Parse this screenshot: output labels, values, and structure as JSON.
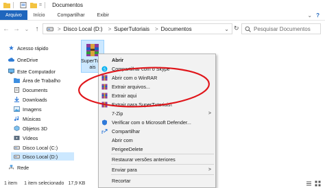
{
  "window": {
    "title": "Documentos",
    "quick_access_divider": "|",
    "dropdown": "="
  },
  "ribbon": {
    "tabs": [
      "Arquivo",
      "Início",
      "Compartilhar",
      "Exibir"
    ],
    "collapse": "⌄",
    "help": "?"
  },
  "address": {
    "back": "←",
    "forward": "→",
    "dropdown": "⌄",
    "up": "↑",
    "path": [
      "Disco Local (D:)",
      "SuperTutoriais",
      "Documentos"
    ],
    "separator": ">",
    "path_dropdown": "⌄",
    "refresh": "↻",
    "search_placeholder": "Pesquisar Documentos"
  },
  "sidebar": {
    "items": [
      {
        "label": "Acesso rápido",
        "icon": "star-icon"
      },
      {
        "label": "OneDrive",
        "icon": "cloud-icon"
      },
      {
        "label": "Este Computador",
        "icon": "computer-icon"
      },
      {
        "label": "Área de Trabalho",
        "icon": "desktop-folder-icon"
      },
      {
        "label": "Documents",
        "icon": "documents-folder-icon"
      },
      {
        "label": "Downloads",
        "icon": "download-icon"
      },
      {
        "label": "Imagens",
        "icon": "pictures-folder-icon"
      },
      {
        "label": "Músicas",
        "icon": "music-icon"
      },
      {
        "label": "Objetos 3D",
        "icon": "objects3d-icon"
      },
      {
        "label": "Vídeos",
        "icon": "video-icon"
      },
      {
        "label": "Disco Local (C:)",
        "icon": "drive-icon"
      },
      {
        "label": "Disco Local (D:)",
        "icon": "drive-icon"
      },
      {
        "label": "Rede",
        "icon": "network-icon"
      }
    ]
  },
  "file": {
    "name": "SuperTutoriais",
    "name_line1": "SuperTutori",
    "name_line2": "ais"
  },
  "context_menu": {
    "items": [
      {
        "label": "Abrir",
        "bold": true
      },
      {
        "label": "Compartilhar com o Skype"
      },
      {
        "label": "Abrir com o WinRAR"
      },
      {
        "label": "Extrair arquivos..."
      },
      {
        "label": "Extrair aqui"
      },
      {
        "label": "Extrair para SuperTutoriais\\"
      },
      {
        "label": "7-Zip",
        "submenu": true
      },
      {
        "label": "Verificar com o Microsoft Defender..."
      },
      {
        "label": "Compartilhar"
      },
      {
        "label": "Abrir com"
      },
      {
        "label": "PerigeeDelete"
      },
      {
        "label": "Restaurar versões anteriores"
      },
      {
        "label": "Enviar para",
        "submenu": true
      },
      {
        "label": "Recortar"
      }
    ],
    "submenu_arrow": ">"
  },
  "status": {
    "count": "1 item",
    "selected": "1 item selecionado",
    "size": "17,9 KB"
  },
  "colors": {
    "accent": "#1f66bd",
    "selection": "#cce8ff",
    "annotation": "#e0161b"
  }
}
